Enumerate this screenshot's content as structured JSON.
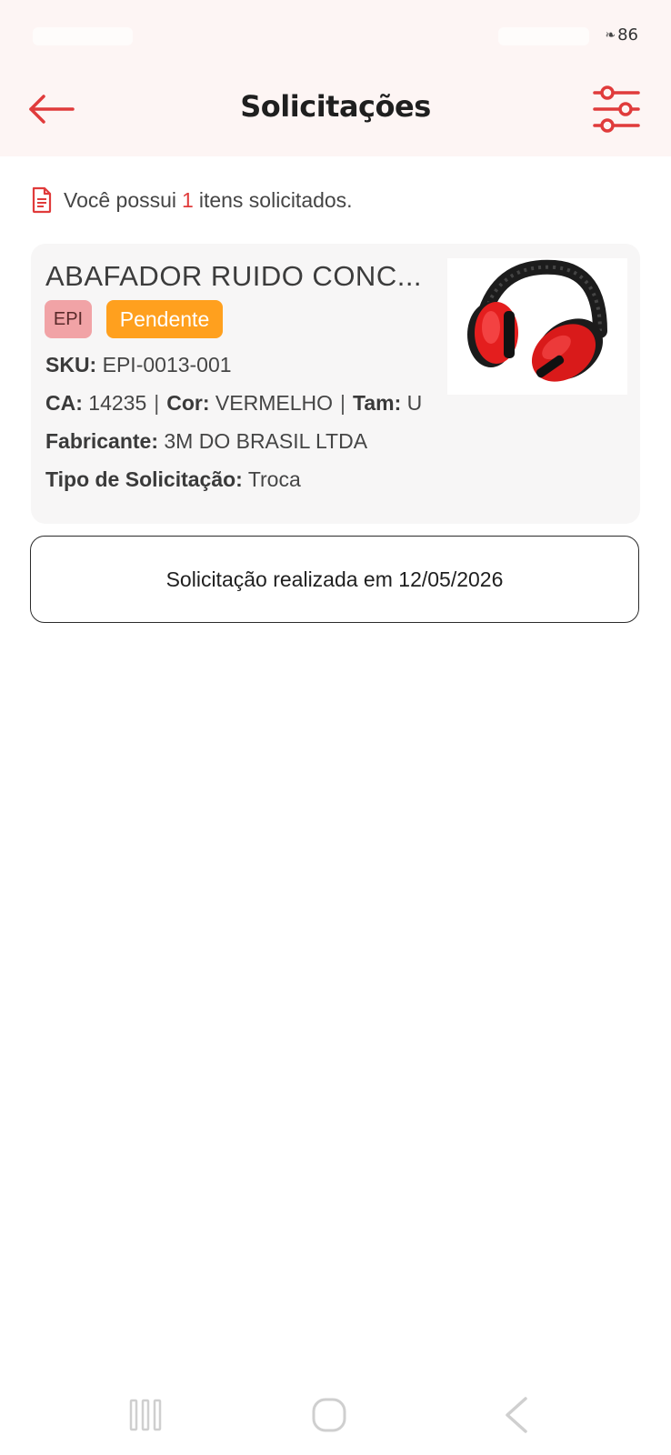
{
  "status_bar": {
    "battery": "86",
    "leaf_icon": "leaf-icon"
  },
  "header": {
    "title": "Solicitações",
    "back_icon": "arrow-left-icon",
    "filter_icon": "sliders-icon",
    "accent": "#e03b3b",
    "background": "#fdf5f4"
  },
  "summary": {
    "icon": "document-icon",
    "prefix": "Você possui",
    "count": "1",
    "suffix": "itens solicitados."
  },
  "item": {
    "name": "ABAFADOR RUIDO CONC...",
    "category_badge": "EPI",
    "status_badge": "Pendente",
    "status_color": "#ffa01e",
    "category_color": "#f1a3a6",
    "sku_label": "SKU:",
    "sku": "EPI-0013-001",
    "ca_label": "CA:",
    "ca": "14235",
    "color_label": "Cor:",
    "color": "VERMELHO",
    "size_label": "Tam:",
    "size": "U",
    "manufacturer_label": "Fabricante:",
    "manufacturer": "3M DO BRASIL LTDA",
    "request_type_label": "Tipo de Solicitação:",
    "request_type": "Troca",
    "image": "red-earmuffs-image"
  },
  "request_date_text": "Solicitação realizada em 12/05/2026",
  "nav": {
    "recent": "recent-apps-icon",
    "home": "home-icon",
    "back": "back-chevron-icon"
  }
}
